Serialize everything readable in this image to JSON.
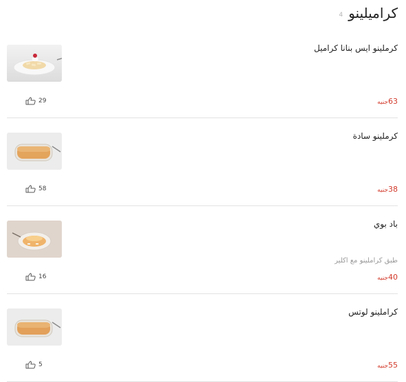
{
  "section": {
    "title": "كراميلينو",
    "count": "4"
  },
  "currency": "جنيه",
  "items": [
    {
      "name": "كرملينو ايس بنانا كراميل",
      "description": "",
      "price": "63",
      "likes": "29",
      "image_icon": "dessert-photo-banana"
    },
    {
      "name": "كرملينو سادة",
      "description": "",
      "price": "38",
      "likes": "58",
      "image_icon": "dessert-photo-plain"
    },
    {
      "name": "باد بوي",
      "description": "طبق كراملينو مع اكلير",
      "price": "40",
      "likes": "16",
      "image_icon": "dessert-photo-eclair"
    },
    {
      "name": "كراملينو لوتس",
      "description": "",
      "price": "55",
      "likes": "5",
      "image_icon": "dessert-photo-lotus"
    }
  ],
  "colors": {
    "price": "#d23a2b",
    "divider": "#e2e2e2"
  }
}
